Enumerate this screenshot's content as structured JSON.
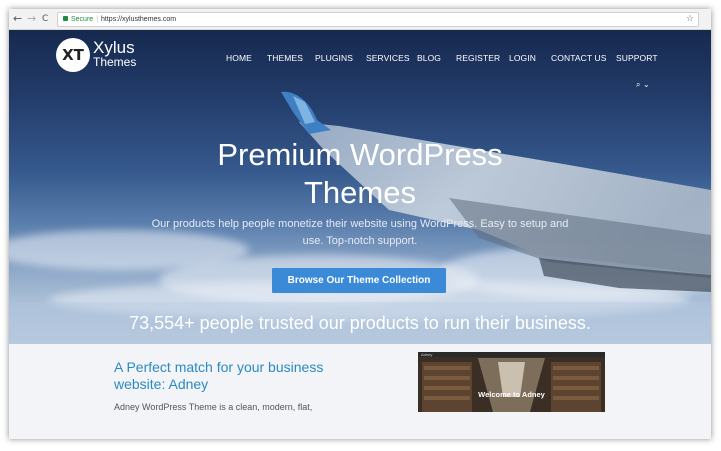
{
  "browser": {
    "back": "←",
    "forward": "→",
    "reload": "C",
    "secure_label": "Secure",
    "url": "https://xylusthemes.com",
    "star": "☆"
  },
  "site": {
    "logo_mark": "XT",
    "brand_line1": "Xylus",
    "brand_line2": "Themes"
  },
  "nav": {
    "items": [
      "HOME",
      "THEMES",
      "PLUGINS",
      "SERVICES",
      "BLOG",
      "REGISTER",
      "LOGIN",
      "CONTACT US",
      "SUPPORT"
    ],
    "search_label": "⌕ ⌄"
  },
  "hero": {
    "title_line1": "Premium WordPress",
    "title_line2": "Themes",
    "subtitle": "Our products help people monetize their website using WordPress. Easy to setup and use. Top-notch support.",
    "cta_label": "Browse Our Theme Collection",
    "trust_text": "73,554+ people trusted our products to run their business."
  },
  "feature": {
    "heading": "A Perfect match for your business website: Adney",
    "description": "Adney WordPress Theme is a clean, modern, flat,",
    "preview_brand": "Adney",
    "preview_caption": "Welcome to Adney"
  },
  "colors": {
    "accent": "#3b8ad8",
    "heading_blue": "#2b8ac6",
    "secure_green": "#1e8e3e"
  }
}
